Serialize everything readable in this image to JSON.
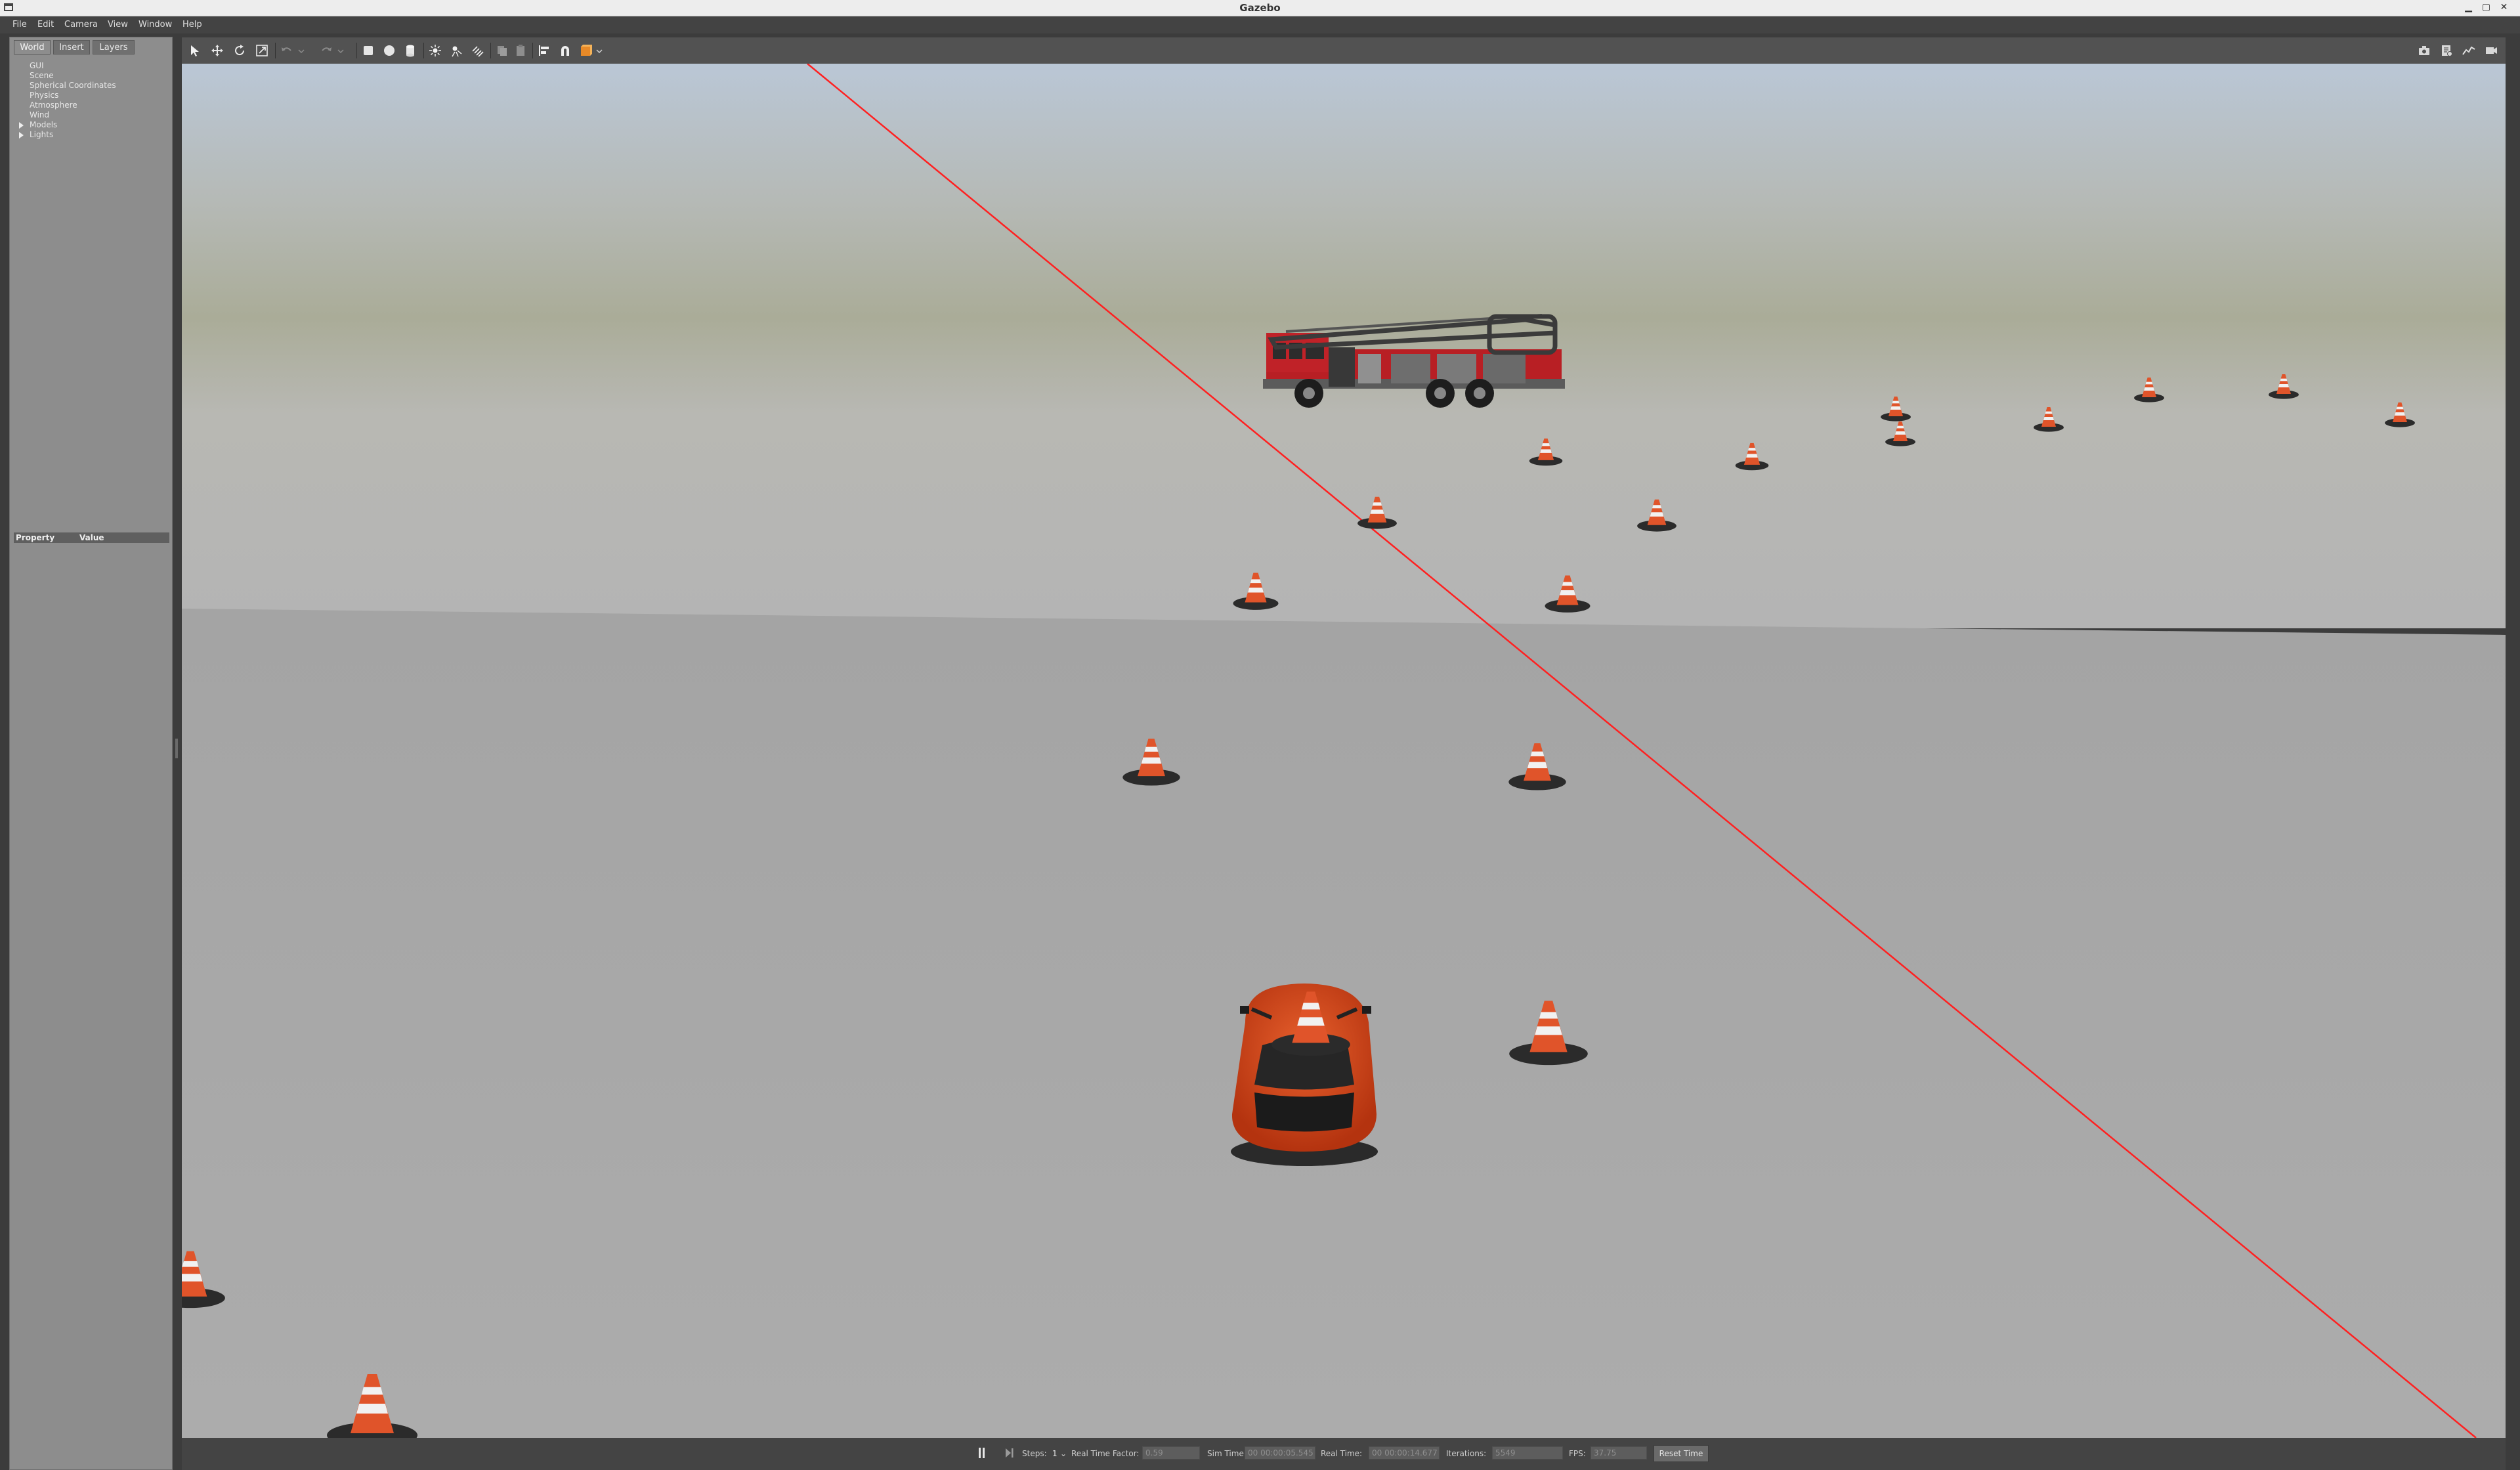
{
  "window": {
    "title": "Gazebo"
  },
  "menu": [
    "File",
    "Edit",
    "Camera",
    "View",
    "Window",
    "Help"
  ],
  "left_panel": {
    "tabs": [
      "World",
      "Insert",
      "Layers"
    ],
    "tree": [
      "GUI",
      "Scene",
      "Spherical Coordinates",
      "Physics",
      "Atmosphere",
      "Wind",
      "Models",
      "Lights"
    ],
    "property_header": {
      "property": "Property",
      "value": "Value"
    }
  },
  "toolbar": {
    "left_tools": [
      "select-mode",
      "translate-mode",
      "rotate-mode",
      "scale-mode",
      "undo",
      "redo",
      "box",
      "sphere",
      "cylinder",
      "point-light",
      "spot-light",
      "directional-light",
      "copy",
      "paste",
      "align",
      "snap",
      "change-view"
    ],
    "right_tools": [
      "screenshot",
      "log",
      "plot",
      "record-video"
    ]
  },
  "bottom_bar": {
    "steps_label": "Steps:",
    "steps_value": "1",
    "real_time_factor_label": "Real Time Factor:",
    "real_time_factor": "0.59",
    "sim_time_label": "Sim Time:",
    "sim_time": "00 00:00:05.545",
    "real_time_label": "Real Time:",
    "real_time": "00 00:00:14.677",
    "iterations_label": "Iterations:",
    "iterations": "5549",
    "fps_label": "FPS:",
    "fps": "37.75",
    "reset_label": "Reset Time"
  },
  "colors": {
    "sky_top": "#bccad8",
    "ground": "#ababab",
    "cone": "#e0542a",
    "car": "#d8471d",
    "truck_red": "#b81f24",
    "axis_line": "#ff2020"
  }
}
